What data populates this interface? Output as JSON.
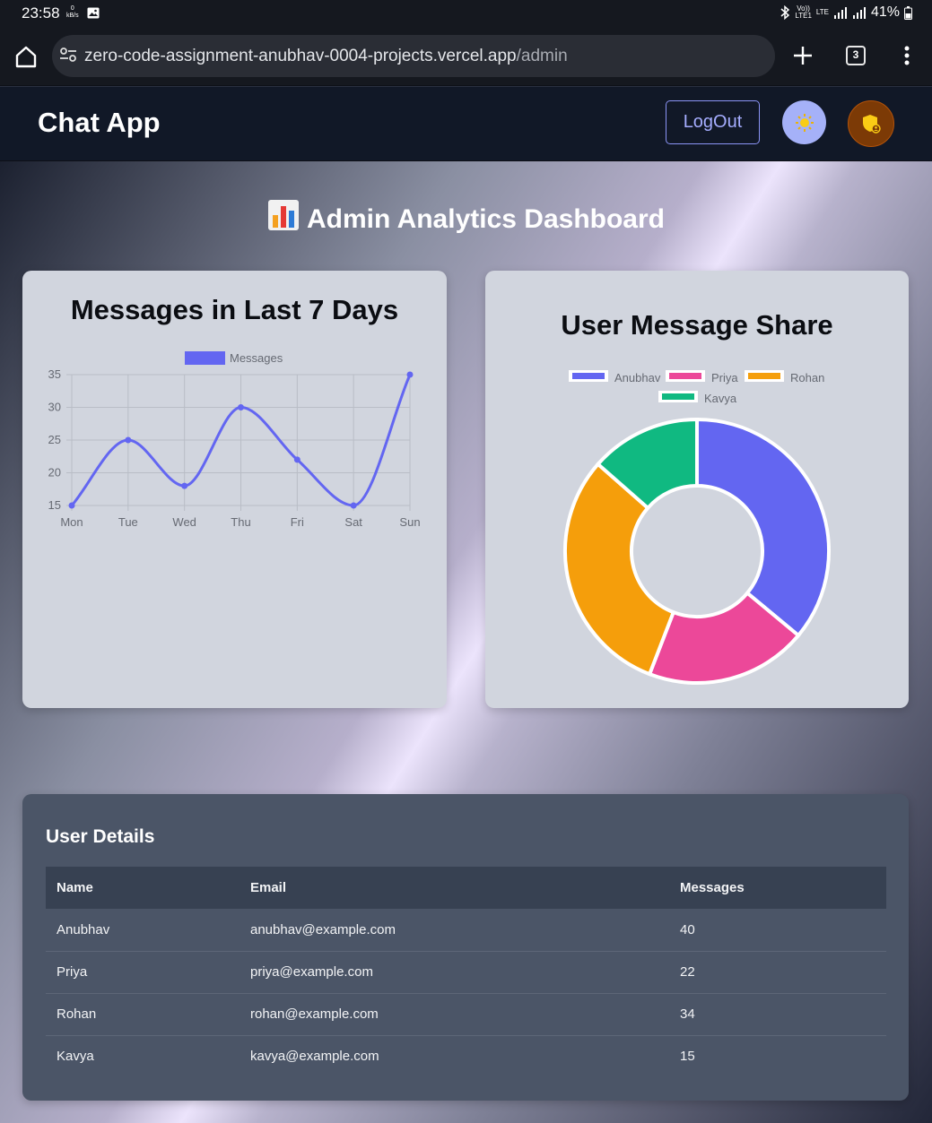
{
  "status_bar": {
    "time": "23:58",
    "net_speed": "0",
    "net_unit": "kB/s",
    "volte": "Vo))",
    "volte_sub": "LTE1",
    "lte": "LTE",
    "battery": "41%"
  },
  "browser": {
    "url_host": "zero-code-assignment-anubhav-0004-projects.vercel.app",
    "url_path": "/admin",
    "tab_count": "3"
  },
  "header": {
    "title": "Chat App",
    "logout_label": "LogOut"
  },
  "dashboard": {
    "title": "Admin Analytics Dashboard"
  },
  "line_card": {
    "title": "Messages in Last 7 Days"
  },
  "pie_card": {
    "title": "User Message Share"
  },
  "chart_data": [
    {
      "type": "line",
      "title": "Messages in Last 7 Days",
      "categories": [
        "Mon",
        "Tue",
        "Wed",
        "Thu",
        "Fri",
        "Sat",
        "Sun"
      ],
      "series": [
        {
          "name": "Messages",
          "values": [
            15,
            25,
            18,
            30,
            22,
            15,
            35
          ],
          "color": "#6366f1"
        }
      ],
      "yticks": [
        15,
        20,
        25,
        30,
        35
      ],
      "ylim": [
        15,
        35
      ],
      "grid": true,
      "legend": "top",
      "curve": "smooth"
    },
    {
      "type": "pie",
      "variant": "doughnut",
      "title": "User Message Share",
      "labels": [
        "Anubhav",
        "Priya",
        "Rohan",
        "Kavya"
      ],
      "values": [
        40,
        22,
        34,
        15
      ],
      "colors": [
        "#6366f1",
        "#ec4899",
        "#f59e0b",
        "#10b981"
      ],
      "legend": "top"
    }
  ],
  "users_table": {
    "title": "User Details",
    "headers": [
      "Name",
      "Email",
      "Messages"
    ],
    "rows": [
      {
        "name": "Anubhav",
        "email": "anubhav@example.com",
        "messages": "40"
      },
      {
        "name": "Priya",
        "email": "priya@example.com",
        "messages": "22"
      },
      {
        "name": "Rohan",
        "email": "rohan@example.com",
        "messages": "34"
      },
      {
        "name": "Kavya",
        "email": "kavya@example.com",
        "messages": "15"
      }
    ]
  },
  "icons": {
    "home": "home-icon",
    "site_info": "tune-icon",
    "new_tab": "plus-icon",
    "tabs": "tab-switcher-icon",
    "menu": "more-vert-icon",
    "theme": "sun-icon",
    "admin": "admin-shield-icon",
    "dashboard": "bar-chart-icon"
  }
}
